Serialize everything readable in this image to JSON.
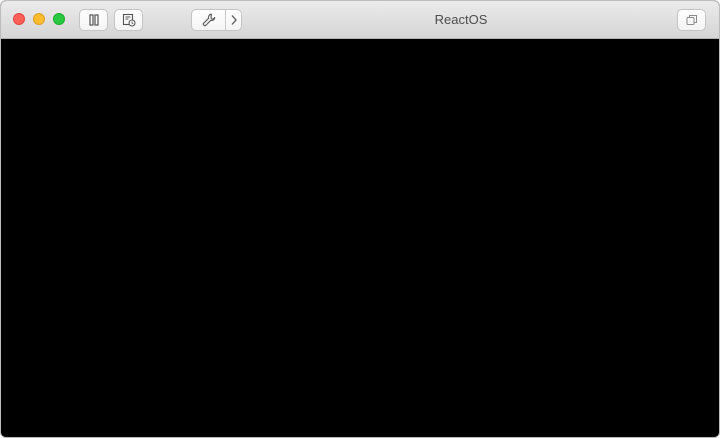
{
  "window": {
    "title": "ReactOS",
    "colors": {
      "close": "#fe5f57",
      "minimize": "#febc2e",
      "zoom": "#28c840",
      "screen": "#000000"
    }
  },
  "toolbar": {
    "icons": {
      "pause": "pause-icon",
      "snapshot": "snapshot-icon",
      "settings": "wrench-icon",
      "more": "chevron-right-icon",
      "fullscreen": "fullscreen-icon"
    }
  }
}
